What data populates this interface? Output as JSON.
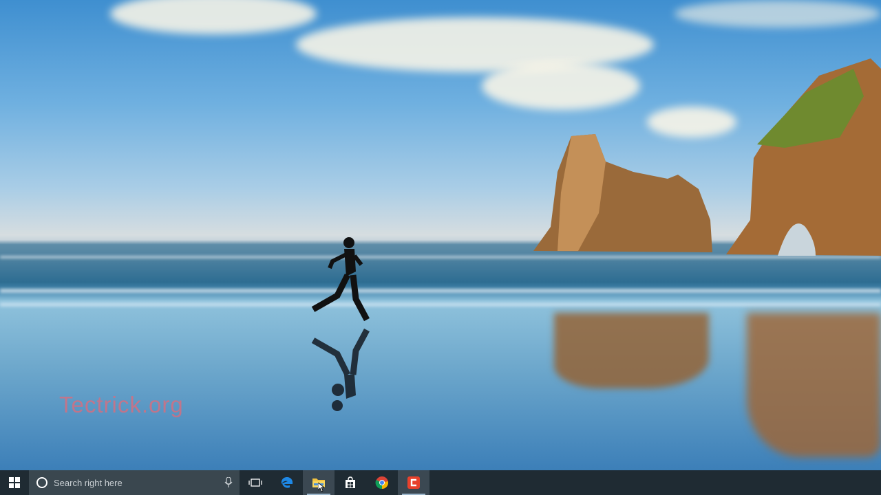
{
  "desktop": {
    "watermark": "Tectrick.org"
  },
  "taskbar": {
    "start_icon": "windows-logo-icon",
    "search": {
      "placeholder": "Search right here",
      "cortana_icon": "cortana-circle-icon",
      "mic_icon": "microphone-icon"
    },
    "task_view_icon": "task-view-icon",
    "pinned_apps": [
      {
        "name": "edge",
        "icon": "edge-icon",
        "active": false
      },
      {
        "name": "file-explorer",
        "icon": "folder-icon",
        "active": true
      },
      {
        "name": "store",
        "icon": "store-icon",
        "active": false
      },
      {
        "name": "chrome",
        "icon": "chrome-icon",
        "active": false
      },
      {
        "name": "camtasia",
        "icon": "camtasia-icon",
        "active": true
      }
    ],
    "colors": {
      "background": "#1f2b33",
      "search_background": "#3a474f",
      "edge_blue": "#1e88e5",
      "camtasia_red": "#e8412c"
    }
  }
}
